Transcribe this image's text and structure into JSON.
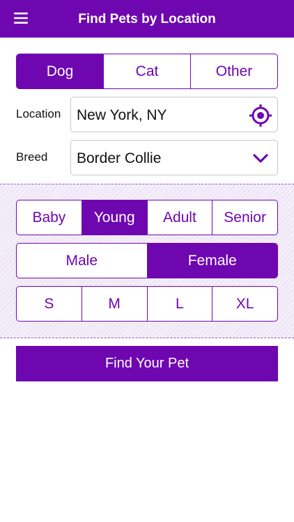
{
  "header": {
    "title": "Find Pets by Location",
    "menu_icon": "hamburger-menu-icon"
  },
  "animal_type": {
    "options": [
      "Dog",
      "Cat",
      "Other"
    ],
    "selected": "Dog"
  },
  "location": {
    "label": "Location",
    "value": "New York, NY",
    "icon": "locate-crosshair-icon"
  },
  "breed": {
    "label": "Breed",
    "value": "Border Collie",
    "icon": "chevron-down-icon"
  },
  "filters": {
    "age": {
      "options": [
        "Baby",
        "Young",
        "Adult",
        "Senior"
      ],
      "selected": "Young"
    },
    "gender": {
      "options": [
        "Male",
        "Female"
      ],
      "selected": "Female"
    },
    "size": {
      "options": [
        "S",
        "M",
        "L",
        "XL"
      ],
      "selected": null
    }
  },
  "cta_label": "Find Your Pet",
  "colors": {
    "accent": "#6e07b0",
    "field_border": "#c8c8c8",
    "band_bg": "#f4eef9"
  }
}
